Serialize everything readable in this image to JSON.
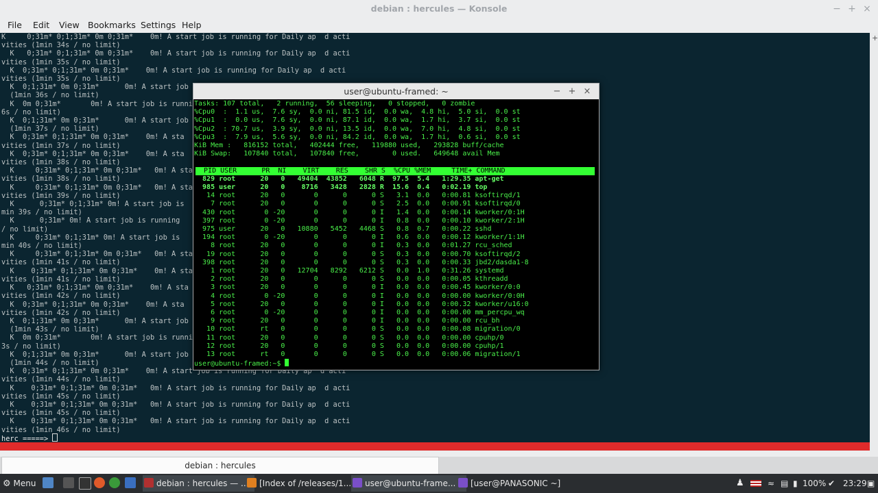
{
  "konsole": {
    "title": "debian : hercules — Konsole",
    "menu": [
      "File",
      "Edit",
      "View",
      "Bookmarks",
      "Settings",
      "Help"
    ],
    "log_lines": [
      "K     0;31m* 0;1;31m* 0m 0;31m*    0m! A start job is running for Daily ap  d acti",
      "vities (1min 34s / no limit)",
      "  K   0;31m* 0;1;31m* 0m 0;31m*    0m! A start job is running for Daily ap  d acti",
      "vities (1min 35s / no limit)",
      "  K  0;31m* 0;1;31m* 0m 0;31m*    0m! A start job is running for Daily ap  d acti",
      "vities (1min 35s / no limit)",
      "  K  0;1;31m* 0m 0;31m*      0m! A start job",
      "  (1min 36s / no limit)",
      "  K  0m 0;31m*       0m! A start job is runni",
      "6s / no limit)",
      "  K  0;1;31m* 0m 0;31m*      0m! A start job",
      "  (1min 37s / no limit)",
      "  K  0;31m* 0;1;31m* 0m 0;31m*    0m! A sta",
      "vities (1min 37s / no limit)",
      "  K  0;31m* 0;1;31m* 0m 0;31m*    0m! A sta",
      "vities (1min 38s / no limit)",
      "  K     0;31m* 0;1;31m* 0m 0;31m*   0m! A sta",
      "vities (1min 38s / no limit)",
      "  K     0;31m* 0;1;31m* 0m 0;31m*   0m! A sta",
      "vities (1min 39s / no limit)",
      "  K      0;31m* 0;1;31m* 0m! A start job is",
      "min 39s / no limit)",
      "  K      0;31m* 0m! A start job is running",
      "/ no limit)",
      "  K     0;31m* 0;1;31m* 0m! A start job is",
      "min 40s / no limit)",
      "  K     0;31m* 0;1;31m* 0m 0;31m*   0m! A sta",
      "vities (1min 41s / no limit)",
      "  K    0;31m* 0;1;31m* 0m 0;31m*    0m! A sta",
      "vities (1min 41s / no limit)",
      "  K   0;31m* 0;1;31m* 0m 0;31m*    0m! A sta",
      "vities (1min 42s / no limit)",
      "  K  0;31m* 0;1;31m* 0m 0;31m*    0m! A sta",
      "vities (1min 42s / no limit)",
      "  K  0;1;31m* 0m 0;31m*      0m! A start job",
      "  (1min 43s / no limit)",
      "  K  0m 0;31m*       0m! A start job is runni",
      "3s / no limit)",
      "  K  0;1;31m* 0m 0;31m*      0m! A start job",
      "  (1min 44s / no limit)",
      "  K  0;31m* 0;1;31m* 0m 0;31m*    0m! A start job is running for Daily ap  d acti",
      "vities (1min 44s / no limit)",
      "  K    0;31m* 0;1;31m* 0m 0;31m*   0m! A start job is running for Daily ap  d acti",
      "vities (1min 45s / no limit)",
      "  K    0;31m* 0;1;31m* 0m 0;31m*   0m! A start job is running for Daily ap  d acti",
      "vities (1min 45s / no limit)",
      "  K    0;31m* 0;1;31m* 0m 0;31m*   0m! A start job is running for Daily ap  d acti",
      "vities (1min 46s / no limit)"
    ],
    "prompt": "herc =====> ",
    "tab_label": "debian : hercules"
  },
  "terminal": {
    "title": "user@ubuntu-framed: ~",
    "summary": [
      "Tasks: 107 total,   2 running,  56 sleeping,   0 stopped,   0 zombie",
      "%Cpu0  :  1.1 us,  7.6 sy,  0.0 ni, 81.5 id,  0.0 wa,  4.8 hi,  5.0 si,  0.0 st",
      "%Cpu1  :  0.0 us,  7.6 sy,  0.0 ni, 87.1 id,  0.0 wa,  1.7 hi,  3.7 si,  0.0 st",
      "%Cpu2  : 70.7 us,  3.9 sy,  0.0 ni, 13.5 id,  0.0 wa,  7.0 hi,  4.8 si,  0.0 st",
      "%Cpu3  :  7.9 us,  5.6 sy,  0.0 ni, 84.2 id,  0.0 wa,  1.7 hi,  0.6 si,  0.0 st",
      "KiB Mem :   816152 total,   402444 free,   119880 used,   293828 buff/cache",
      "KiB Swap:   107840 total,   107840 free,        0 used.   649648 avail Mem"
    ],
    "header": "  PID USER      PR  NI    VIRT    RES    SHR S  %CPU %MEM     TIME+ COMMAND",
    "processes": [
      "  829 root      20   0   49404  43852   6048 R  97.5  5.4   1:29.35 apt-get",
      "  985 user      20   0    8716   3428   2828 R  15.6  0.4   0:02.19 top",
      "   14 root      20   0       0      0      0 S   3.1  0.0   0:00.81 ksoftirqd/1",
      "    7 root      20   0       0      0      0 S   2.5  0.0   0:00.91 ksoftirqd/0",
      "  430 root       0 -20       0      0      0 I   1.4  0.0   0:00.14 kworker/0:1H",
      "  397 root       0 -20       0      0      0 I   0.8  0.0   0:00.10 kworker/2:1H",
      "  975 user      20   0   10880   5452   4468 S   0.8  0.7   0:00.22 sshd",
      "  194 root       0 -20       0      0      0 I   0.6  0.0   0:00.12 kworker/1:1H",
      "    8 root      20   0       0      0      0 I   0.3  0.0   0:01.27 rcu_sched",
      "   19 root      20   0       0      0      0 S   0.3  0.0   0:00.70 ksoftirqd/2",
      "  398 root      20   0       0      0      0 S   0.3  0.0   0:00.33 jbd2/dasda1-8",
      "    1 root      20   0   12704   8292   6212 S   0.0  1.0   0:31.26 systemd",
      "    2 root      20   0       0      0      0 S   0.0  0.0   0:00.05 kthreadd",
      "    3 root      20   0       0      0      0 I   0.0  0.0   0:00.45 kworker/0:0",
      "    4 root       0 -20       0      0      0 I   0.0  0.0   0:00.00 kworker/0:0H",
      "    5 root      20   0       0      0      0 I   0.0  0.0   0:00.32 kworker/u16:0",
      "    6 root       0 -20       0      0      0 I   0.0  0.0   0:00.00 mm_percpu_wq",
      "    9 root      20   0       0      0      0 I   0.0  0.0   0:00.00 rcu_bh",
      "   10 root      rt   0       0      0      0 S   0.0  0.0   0:00.08 migration/0",
      "   11 root      20   0       0      0      0 S   0.0  0.0   0:00.00 cpuhp/0",
      "   12 root      20   0       0      0      0 S   0.0  0.0   0:00.00 cpuhp/1",
      "   13 root      rt   0       0      0      0 S   0.0  0.0   0:00.06 migration/1"
    ],
    "prompt": "user@ubuntu-framed:~$ "
  },
  "taskbar": {
    "menu_label": "Menu",
    "tasks": [
      {
        "label": "debian : hercules — ...",
        "active": true,
        "color": "#b03030"
      },
      {
        "label": "[Index of /releases/1...",
        "active": false,
        "color": "#e08020"
      },
      {
        "label": "user@ubuntu-frame...",
        "active": true,
        "color": "#7a4fc8"
      },
      {
        "label": "[user@PANASONIC ~]",
        "active": false,
        "color": "#7a4fc8"
      }
    ],
    "battery": "100%",
    "clock": "23:29"
  },
  "colors": {
    "konsole_bg": "#0b2530",
    "top_green": "#33ff33",
    "status_red": "#e02b2b",
    "taskbar_bg": "#2a2d30"
  }
}
